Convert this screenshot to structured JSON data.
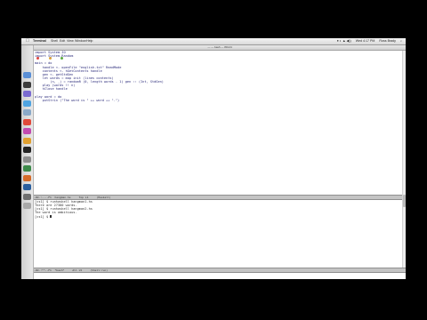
{
  "menubar": {
    "apple_symbol": "",
    "app_name": "Terminal",
    "menus": [
      "Shell",
      "Edit",
      "View",
      "Window",
      "Help"
    ],
    "clock": "Wed 4:17 PM",
    "user": "Ross Brady"
  },
  "window": {
    "title": "— — bash — 80×24"
  },
  "dock": {
    "icons": [
      {
        "name": "finder-icon",
        "color": "#5a8fd6"
      },
      {
        "name": "dashboard-icon",
        "color": "#3c3c3c"
      },
      {
        "name": "mission-control-icon",
        "color": "#7a6ad0"
      },
      {
        "name": "safari-icon",
        "color": "#4fa3e0"
      },
      {
        "name": "mail-icon",
        "color": "#8aa9c8"
      },
      {
        "name": "calendar-icon",
        "color": "#e04a3a"
      },
      {
        "name": "itunes-icon",
        "color": "#c24ab0"
      },
      {
        "name": "photos-icon",
        "color": "#e0a030"
      },
      {
        "name": "terminal-icon",
        "color": "#222222"
      },
      {
        "name": "preferences-icon",
        "color": "#8c8c8c"
      },
      {
        "name": "app-icon-1",
        "color": "#3d8a4a"
      },
      {
        "name": "app-icon-2",
        "color": "#d46b2a"
      },
      {
        "name": "app-icon-3",
        "color": "#2a5f9e"
      },
      {
        "name": "app-icon-4",
        "color": "#6f6f6f"
      },
      {
        "name": "trash-icon",
        "color": "#a8a8a8"
      }
    ]
  },
  "editor": {
    "lines": [
      "import System.IO",
      "import System.Random",
      "",
      "main = do",
      "    handle <- openFile \"english.txt\" ReadMode",
      "    contents <- hGetContents handle",
      "    gen <- getStdGen",
      "    let words = map init (lines contents)",
      "        (n, _) = randomR (0, length words - 1) gen :: (Int, StdGen)",
      "    play (words !! n)",
      "    hClose handle",
      "",
      "play word = do",
      "    putStrLn (\"The word is \" ++ word ++ \".\")"
    ],
    "modeline": "-UU-:----F1  hangman.hs     Top L1     (Haskell)"
  },
  "terminal": {
    "lines": [
      "[cs1] $ runhaskell hangman1.hs",
      "There are 27380 words.",
      "[cs1] $ runhaskell hangman2.hs",
      "The word is ambitious.",
      "[cs1] $ "
    ],
    "modeline": "-UU-:**--F1  *bash*     All L5     (Shell:run)"
  }
}
